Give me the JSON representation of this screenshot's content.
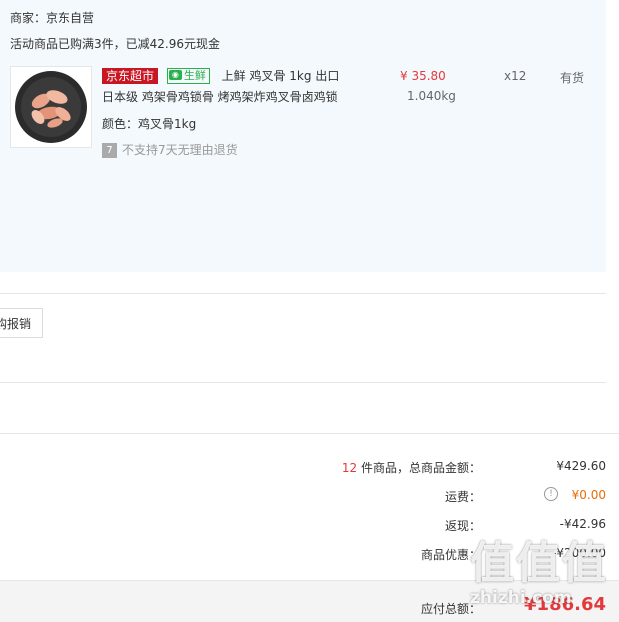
{
  "shop": {
    "label": "商家：京东自营"
  },
  "promotion": {
    "text": "活动商品已购满3件，已减42.96元现金"
  },
  "product": {
    "tag_supermarket": "京东超市",
    "tag_fresh": "生鲜",
    "tag_fresh_icon": "fresh-leaf-icon",
    "title_line1": "上鲜 鸡叉骨 1kg 出口",
    "title_line2": "日本级 鸡架骨鸡锁骨 烤鸡架炸鸡叉骨卤鸡锁",
    "color": "颜色：鸡叉骨1kg",
    "return_icon_text": "7",
    "return_policy": "不支持7天无理由退货",
    "price": "¥ 35.80",
    "weight": "1.040kg",
    "quantity": "x12",
    "stock": "有货"
  },
  "actions": {
    "reimburse": "购报销"
  },
  "summary": {
    "count": "12",
    "count_suffix": " 件商品，总商品金额：",
    "total": "¥429.60",
    "shipping_label": "运费：",
    "shipping": "¥0.00",
    "rebate_label": "返现：",
    "rebate": "-¥42.96",
    "discount_label": "商品优惠：",
    "discount": "-¥200.00",
    "payable_label": "应付总额：",
    "payable": "¥186.64"
  },
  "watermark": {
    "chars": [
      "值",
      "值",
      "值"
    ],
    "url": "zhizhi.com"
  },
  "colors": {
    "accent_red": "#e4393c",
    "fresh_green": "#2bb14b",
    "panel_blue": "#f3f9fd",
    "shipping_orange": "#e66e0a"
  }
}
